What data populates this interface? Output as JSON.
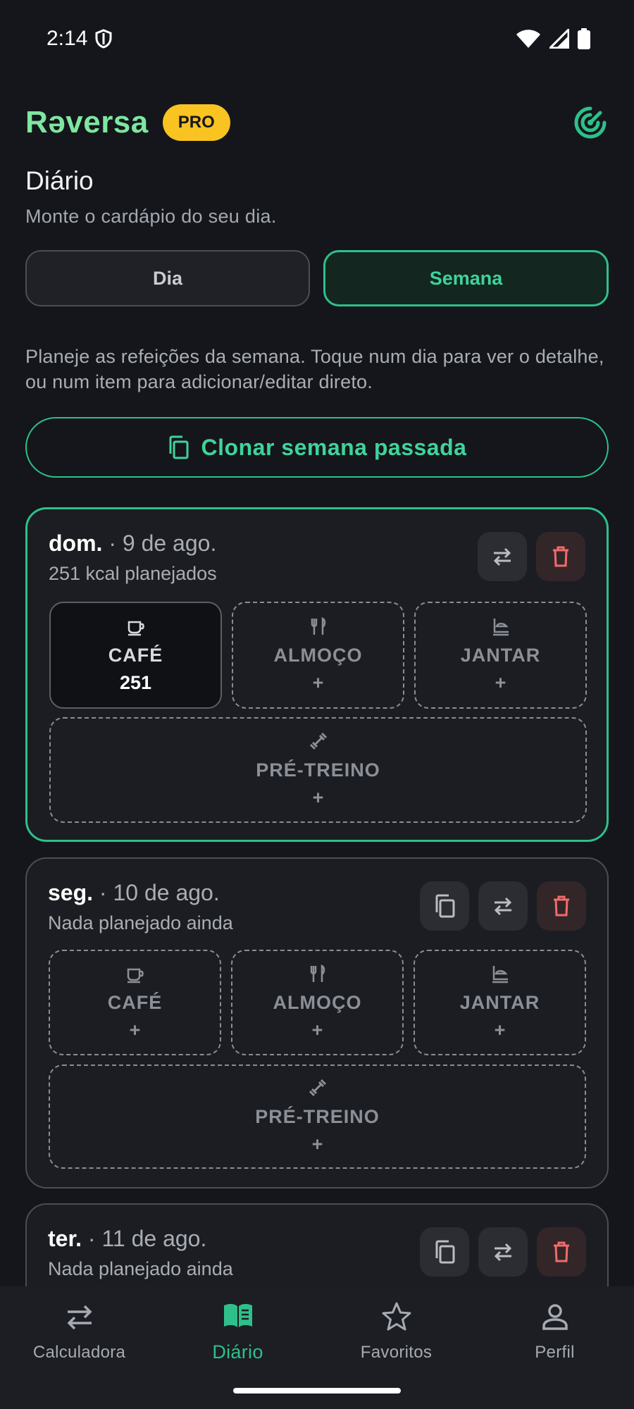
{
  "status_bar": {
    "time": "2:14",
    "icons": [
      "shield-icon",
      "wifi-icon",
      "signal-icon",
      "battery-icon"
    ]
  },
  "header": {
    "brand": "Rəversa",
    "badge": "PRO",
    "icon": "target-icon"
  },
  "page": {
    "title": "Diário",
    "subtitle": "Monte o cardápio do seu dia."
  },
  "tabs": {
    "day": "Dia",
    "week": "Semana",
    "selected": "Semana"
  },
  "intro": "Planeje as refeições da semana. Toque num dia para ver o detalhe, ou num item para adicionar/editar direto.",
  "clone_button": "Clonar semana passada",
  "days": [
    {
      "weekday": "dom.",
      "date": "· 9 de ago.",
      "summary": "251 kcal planejados",
      "slots": [
        {
          "name": "CAFÉ",
          "value": "251",
          "icon": "coffee-cup-icon"
        },
        {
          "name": "ALMOÇO",
          "value": "+",
          "icon": "fork-knife-icon"
        },
        {
          "name": "JANTAR",
          "value": "+",
          "icon": "dinner-icon"
        },
        {
          "name": "PRÉ-TREINO",
          "value": "+",
          "icon": "dumbbell-icon"
        }
      ]
    },
    {
      "weekday": "seg.",
      "date": "· 10 de ago.",
      "summary": "Nada planejado ainda",
      "slots": [
        {
          "name": "CAFÉ",
          "value": "+",
          "icon": "coffee-cup-icon"
        },
        {
          "name": "ALMOÇO",
          "value": "+",
          "icon": "fork-knife-icon"
        },
        {
          "name": "JANTAR",
          "value": "+",
          "icon": "dinner-icon"
        },
        {
          "name": "PRÉ-TREINO",
          "value": "+",
          "icon": "dumbbell-icon"
        }
      ]
    },
    {
      "weekday": "ter.",
      "date": "· 11 de ago.",
      "summary": "Nada planejado ainda"
    }
  ],
  "nav": [
    {
      "label": "Calculadora",
      "icon": "swap-arrows-icon"
    },
    {
      "label": "Diário",
      "icon": "open-book-icon",
      "active": true
    },
    {
      "label": "Favoritos",
      "icon": "star-icon"
    },
    {
      "label": "Perfil",
      "icon": "person-icon"
    }
  ],
  "colors": {
    "accent": "#2ec08a",
    "brand": "#7ee6a0",
    "badge": "#f9c321",
    "danger": "#f26b6b",
    "background": "#14161b"
  }
}
